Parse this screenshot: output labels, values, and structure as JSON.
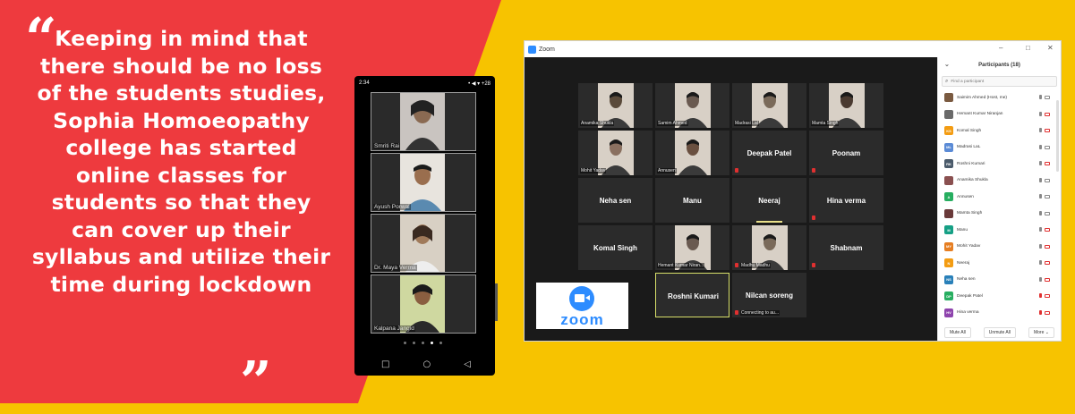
{
  "quote": {
    "text": "Keeping in mind that there should be no loss of the students studies, Sophia Homoeopathy college has started online classes for students so that they can cover up their syllabus and utilize their time during lockdown",
    "open_mark": "“",
    "close_mark": "”"
  },
  "colors": {
    "red": "#ee3a3e",
    "yellow": "#f7c300",
    "zoom_blue": "#2d8cff"
  },
  "phone": {
    "time": "2:34",
    "status_right": "• ◀ ▾ +28",
    "tiles": [
      {
        "name": "Smriti Rai"
      },
      {
        "name": "Ayush Porwal"
      },
      {
        "name": "Dr. Maya Verma"
      },
      {
        "name": "Kalpana Jangid"
      }
    ],
    "nav": {
      "back": "◁",
      "home": "○",
      "recent": "□"
    }
  },
  "zoom": {
    "title": "Zoom",
    "window_controls": {
      "minimize": "–",
      "maximize": "□",
      "close": "✕"
    },
    "grid": [
      [
        {
          "label": "Anamika Shukla",
          "video": true
        },
        {
          "label": "Samim Ahmed",
          "video": true
        },
        {
          "label": "Madrasi Lal",
          "video": true
        },
        {
          "label": "Mamta Singh",
          "video": true
        }
      ],
      [
        {
          "label": "Mohit Yadav",
          "video": true
        },
        {
          "label": "Annusen",
          "video": true
        },
        {
          "name": "Deepak Patel",
          "muted": true
        },
        {
          "name": "Poonam",
          "muted": true
        }
      ],
      [
        {
          "name": "Neha sen"
        },
        {
          "name": "Manu"
        },
        {
          "name": "Neeraj",
          "speaking": true
        },
        {
          "name": "Hina verma",
          "muted": true
        }
      ],
      [
        {
          "name": "Komal Singh"
        },
        {
          "label": "Hemant Kumar Niran...",
          "video": true
        },
        {
          "label": "Madhu Madhu",
          "video": true,
          "muted": true
        },
        {
          "name": "Shabnam",
          "muted": true
        }
      ],
      [
        {
          "empty": true
        },
        {
          "name": "Roshni Kumari",
          "active": true
        },
        {
          "name": "Nilcan soreng",
          "label": "Connecting to au...",
          "muted": true
        },
        {
          "empty": true
        }
      ]
    ],
    "badge_text": "zoom",
    "panel": {
      "title": "Participants (18)",
      "search_placeholder": "Find a participant",
      "participants": [
        {
          "name": "Saimim Ahmed (Host, me)",
          "initials": "",
          "color": "#7a5a40",
          "mic_red": false,
          "vid_red": false
        },
        {
          "name": "Hemant Kumar Niranjan",
          "initials": "",
          "color": "#6a6a6a",
          "mic_red": false,
          "vid_red": true
        },
        {
          "name": "Komal Singh",
          "initials": "KS",
          "color": "#f39c12",
          "mic_red": false,
          "vid_red": true
        },
        {
          "name": "Madrasi LaL",
          "initials": "ML",
          "color": "#5b8bd6",
          "mic_red": false,
          "vid_red": false
        },
        {
          "name": "Roshni Kumari",
          "initials": "RK",
          "color": "#4a5a6a",
          "mic_red": false,
          "vid_red": true
        },
        {
          "name": "Anamika Shukla",
          "initials": "",
          "color": "#8a5050",
          "mic_red": false,
          "vid_red": false
        },
        {
          "name": "Annusen",
          "initials": "A",
          "color": "#27ae60",
          "mic_red": false,
          "vid_red": false
        },
        {
          "name": "Mamta Singh",
          "initials": "",
          "color": "#6a3a3a",
          "mic_red": false,
          "vid_red": false
        },
        {
          "name": "Manu",
          "initials": "M",
          "color": "#16a085",
          "mic_red": false,
          "vid_red": true
        },
        {
          "name": "Mohit Yadav",
          "initials": "MY",
          "color": "#e67e22",
          "mic_red": false,
          "vid_red": true
        },
        {
          "name": "Neeraj",
          "initials": "N",
          "color": "#f39c12",
          "mic_red": false,
          "vid_red": true
        },
        {
          "name": "Neha sen",
          "initials": "NS",
          "color": "#2980b9",
          "mic_red": false,
          "vid_red": true
        },
        {
          "name": "Deepak Patel",
          "initials": "DP",
          "color": "#27ae60",
          "mic_red": true,
          "vid_red": true
        },
        {
          "name": "Hina verma",
          "initials": "HV",
          "color": "#8e44ad",
          "mic_red": true,
          "vid_red": true
        }
      ],
      "buttons": {
        "mute_all": "Mute All",
        "unmute_all": "Unmute All",
        "more": "More ⌄"
      }
    }
  }
}
